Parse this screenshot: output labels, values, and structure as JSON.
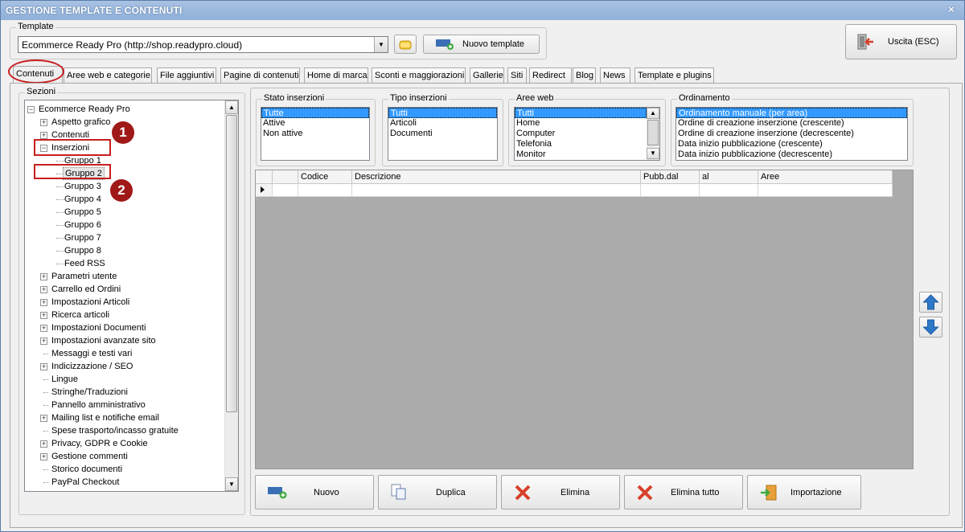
{
  "window": {
    "title": "GESTIONE TEMPLATE E CONTENUTI",
    "close_glyph": "×"
  },
  "template": {
    "group_label": "Template",
    "selected": "Ecommerce Ready Pro (http://shop.readypro.cloud)",
    "new_template_label": "Nuovo template"
  },
  "exit_label": "Uscita (ESC)",
  "tabs": [
    {
      "label": "Contenuti",
      "active": true
    },
    {
      "label": "Aree web e categorie"
    },
    {
      "label": "File aggiuntivi"
    },
    {
      "label": "Pagine di contenuti"
    },
    {
      "label": "Home di marca"
    },
    {
      "label": "Sconti e maggiorazioni"
    },
    {
      "label": "Gallerie"
    },
    {
      "label": "Siti"
    },
    {
      "label": "Redirect"
    },
    {
      "label": "Blog"
    },
    {
      "label": "News"
    },
    {
      "label": "Template e plugins"
    }
  ],
  "sections": {
    "group_label": "Sezioni",
    "tree": [
      {
        "label": "Ecommerce Ready Pro",
        "expander": "minus",
        "level": 0
      },
      {
        "label": "Aspetto grafico",
        "expander": "plus",
        "level": 1
      },
      {
        "label": "Contenuti",
        "expander": "plus",
        "level": 1
      },
      {
        "label": "Inserzioni",
        "expander": "minus",
        "level": 1
      },
      {
        "label": "Gruppo 1",
        "expander": "none",
        "level": 2
      },
      {
        "label": "Gruppo 2",
        "expander": "none",
        "level": 2,
        "selected": true
      },
      {
        "label": "Gruppo 3",
        "expander": "none",
        "level": 2
      },
      {
        "label": "Gruppo 4",
        "expander": "none",
        "level": 2
      },
      {
        "label": "Gruppo 5",
        "expander": "none",
        "level": 2
      },
      {
        "label": "Gruppo 6",
        "expander": "none",
        "level": 2
      },
      {
        "label": "Gruppo 7",
        "expander": "none",
        "level": 2
      },
      {
        "label": "Gruppo 8",
        "expander": "none",
        "level": 2
      },
      {
        "label": "Feed RSS",
        "expander": "none",
        "level": 2
      },
      {
        "label": "Parametri utente",
        "expander": "plus",
        "level": 1
      },
      {
        "label": "Carrello ed Ordini",
        "expander": "plus",
        "level": 1
      },
      {
        "label": "Impostazioni Articoli",
        "expander": "plus",
        "level": 1
      },
      {
        "label": "Ricerca articoli",
        "expander": "plus",
        "level": 1
      },
      {
        "label": "Impostazioni Documenti",
        "expander": "plus",
        "level": 1
      },
      {
        "label": "Impostazioni avanzate sito",
        "expander": "plus",
        "level": 1
      },
      {
        "label": "Messaggi e testi vari",
        "expander": "none",
        "level": 1
      },
      {
        "label": "Indicizzazione / SEO",
        "expander": "plus",
        "level": 1
      },
      {
        "label": "Lingue",
        "expander": "none",
        "level": 1
      },
      {
        "label": "Stringhe/Traduzioni",
        "expander": "none",
        "level": 1
      },
      {
        "label": "Pannello amministrativo",
        "expander": "none",
        "level": 1
      },
      {
        "label": "Mailing list e notifiche email",
        "expander": "plus",
        "level": 1
      },
      {
        "label": "Spese trasporto/incasso gratuite",
        "expander": "none",
        "level": 1
      },
      {
        "label": "Privacy, GDPR e Cookie",
        "expander": "plus",
        "level": 1
      },
      {
        "label": "Gestione commenti",
        "expander": "plus",
        "level": 1
      },
      {
        "label": "Storico documenti",
        "expander": "none",
        "level": 1
      },
      {
        "label": "PayPal Checkout",
        "expander": "none",
        "level": 1
      }
    ]
  },
  "filters": {
    "stato": {
      "label": "Stato inserzioni",
      "items": [
        "Tutte",
        "Attive",
        "Non attive"
      ],
      "selected": 0
    },
    "tipo": {
      "label": "Tipo inserzioni",
      "items": [
        "Tutti",
        "Articoli",
        "Documenti"
      ],
      "selected": 0
    },
    "aree": {
      "label": "Aree web",
      "items": [
        "Tutti",
        "Home",
        "Computer",
        "Telefonia",
        "Monitor"
      ],
      "selected": 0
    },
    "ordinamento": {
      "label": "Ordinamento",
      "items": [
        "Ordinamento manuale (per area)",
        "Ordine di creazione inserzione (crescente)",
        "Ordine di creazione inserzione (decrescente)",
        "Data inizio pubblicazione (crescente)",
        "Data inizio pubblicazione (decrescente)"
      ],
      "selected": 0
    }
  },
  "grid": {
    "columns": [
      "",
      "",
      "Codice",
      "Descrizione",
      "Pubb.dal",
      "al",
      "Aree"
    ]
  },
  "actions": {
    "nuovo": "Nuovo",
    "duplica": "Duplica",
    "elimina": "Elimina",
    "elimina_tutto": "Elimina tutto",
    "importazione": "Importazione"
  },
  "annotations": {
    "badge1": "1",
    "badge2": "2"
  },
  "colors": {
    "title_bar": "#8fb0d9",
    "selection": "#3399ff",
    "annotation_red": "#c81e1e",
    "badge": "#a01818",
    "arrow_blue": "#2f78c8"
  }
}
